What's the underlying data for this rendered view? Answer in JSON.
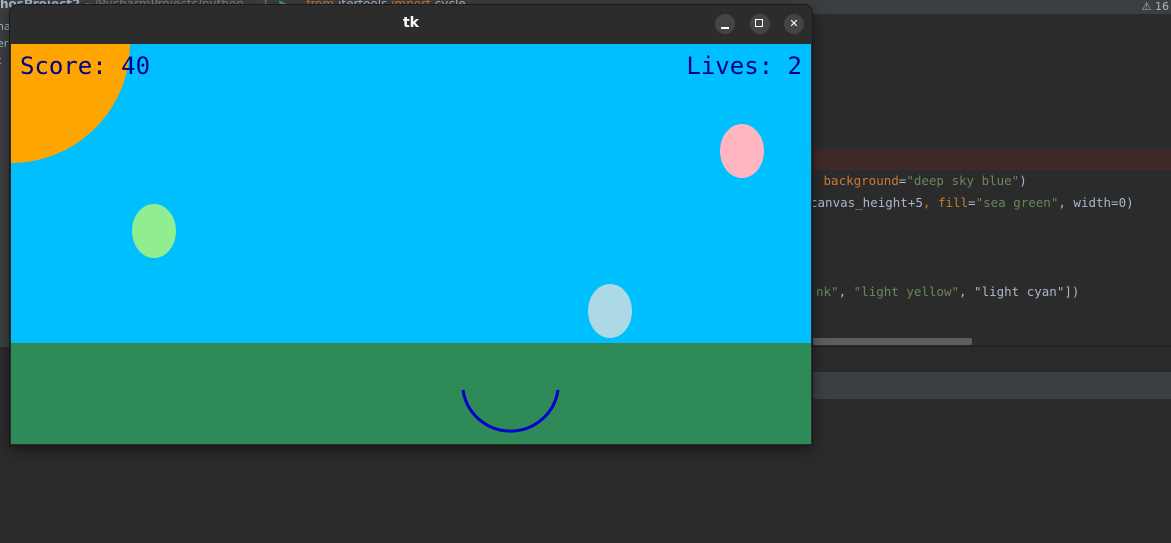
{
  "ide": {
    "path_project": "hosProject2",
    "path_dir": "~/PycharmProjects/python",
    "line_number": "1",
    "code_keyword_from": "from",
    "code_module": "itertools",
    "code_keyword_import": "import",
    "code_name": "cycle",
    "warnings_count": "⚠ 16",
    "code_lines": [
      {
        "before": " ",
        "kw": "background",
        "eq": "=",
        "str": "\"deep sky blue\"",
        "after": ")"
      },
      {
        "before": "canvas_height+5",
        "kw": ", fill",
        "eq": "=",
        "str": "\"sea green\"",
        "after": ", width=0)"
      },
      {
        "before": "nk\"",
        "kw": ", ",
        "eq": "",
        "str": "\"light yellow\"",
        "after": ", \"light cyan\"])"
      }
    ],
    "left_labels": [
      "ha",
      "er",
      "t"
    ]
  },
  "window": {
    "title": "tk",
    "min_glyph": "–",
    "max_glyph": "□",
    "close_glyph": "✕"
  },
  "game": {
    "score_text": "Score: 40",
    "lives_text": "Lives: 2",
    "score": 40,
    "lives": 2,
    "colors": {
      "sky": "#00bfff",
      "ground": "#2e8b57",
      "sun": "#ffa500",
      "hud_text": "#00008b",
      "catcher": "#0000cd",
      "egg_pink": "#ffb6c1",
      "egg_green": "#90ee90",
      "egg_cyan": "#add8e6"
    }
  }
}
